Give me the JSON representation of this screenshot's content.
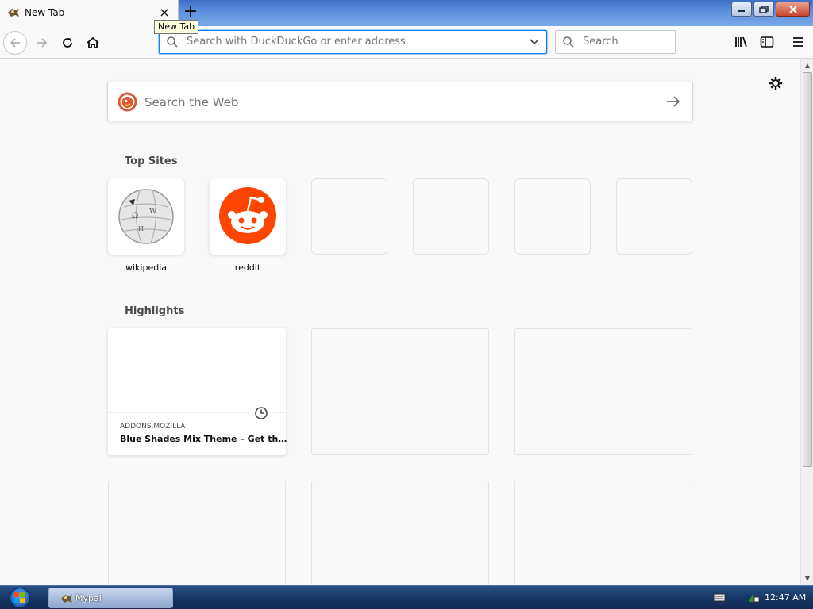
{
  "window": {
    "tab": {
      "title": "New Tab",
      "close": "×"
    },
    "new_tab_symbol": "+",
    "tooltip": "New Tab"
  },
  "toolbar": {
    "url_placeholder": "Search with DuckDuckGo or enter address",
    "search_placeholder": "Search",
    "icons": [
      "back-icon",
      "forward-icon",
      "reload-icon",
      "home-icon",
      "library-icon",
      "sidebar-icon",
      "menu-icon"
    ]
  },
  "newtab": {
    "web_search_placeholder": "Search the Web",
    "top_sites": {
      "title": "Top Sites",
      "sites": [
        {
          "label": "wikipedia",
          "icon": "wikipedia-icon"
        },
        {
          "label": "reddit",
          "icon": "reddit-icon",
          "color": "#ff4500"
        }
      ]
    },
    "highlights": {
      "title": "Highlights",
      "cards": [
        {
          "domain": "ADDONS.MOZILLA",
          "title": "Blue Shades Mix Theme – Get th…"
        }
      ]
    }
  },
  "taskbar": {
    "app_label": "Mypal",
    "clock": "12:47 AM"
  },
  "colors": {
    "accent": "#0a84ff",
    "page_bg": "#f9f9fa",
    "reddit": "#ff4500"
  }
}
